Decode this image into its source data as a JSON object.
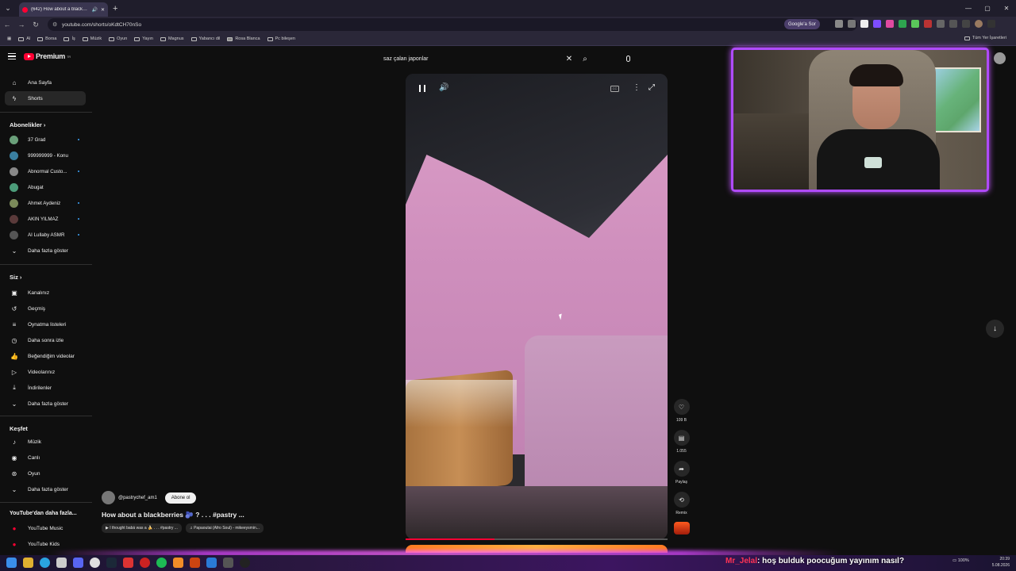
{
  "browser": {
    "tab_title": "(642) How about a blackb...",
    "address": "youtube.com/shorts/oKdtCH70nSo",
    "google_btn": "Google'a Sor",
    "bookmarks": [
      "Al",
      "Borsa",
      "İş",
      "Müzik",
      "Oyun",
      "Yayın",
      "Magnus",
      "Yabancı dil",
      "Rosa Blanca",
      "Pc bileşen"
    ],
    "all_bookmarks": "Tüm Yer İşaretleri"
  },
  "youtube": {
    "logo": "Premium",
    "logo_sup": "TR",
    "nav": {
      "home": "Ana Sayfa",
      "shorts": "Shorts"
    },
    "subs_head": "Abonelikler",
    "subscriptions": [
      "37 Grad",
      "999999999 - Konu",
      "Abnormal Custo...",
      "Abugat",
      "Ahmet Aydeniz",
      "AKIN YILMAZ",
      "AI Lullaby ASMR"
    ],
    "show_more": "Daha fazla göster",
    "you_head": "Siz",
    "you_items": [
      "Kanalınız",
      "Geçmiş",
      "Oynatma listeleri",
      "Daha sonra izle",
      "Beğendiğim videolar",
      "Videolarınız",
      "İndirilenler",
      "Daha fazla göster"
    ],
    "explore_head": "Keşfet",
    "explore_items": [
      "Müzik",
      "Canlı",
      "Oyun",
      "Daha fazla göster"
    ],
    "more_head": "YouTube'dan daha fazla...",
    "more_items": [
      "YouTube Music",
      "YouTube Kids"
    ],
    "search_query": "saz çalan japonlar"
  },
  "short": {
    "channel": "@pastrychef_am1",
    "subscribe": "Abone ol",
    "title": "How about a blackberries 🫐 ? . . . #pastry ...",
    "chip1": "▶ I thought babá was a 🍌 . . . #pastry ...",
    "chip2": "♫ Papaoutai (Afro Soul) - mikeeysmin...",
    "likes": "109 B",
    "comments": "1.055",
    "share": "Paylaş",
    "remix": "Remix",
    "progress": 0.34
  },
  "overlay": {
    "chat_user": "Mr_Jelal",
    "chat_msg": ": hoş bulduk poocuğum yayınım nasıl?",
    "battery": "100%",
    "time": "20:39",
    "date": "5.08.2026"
  }
}
